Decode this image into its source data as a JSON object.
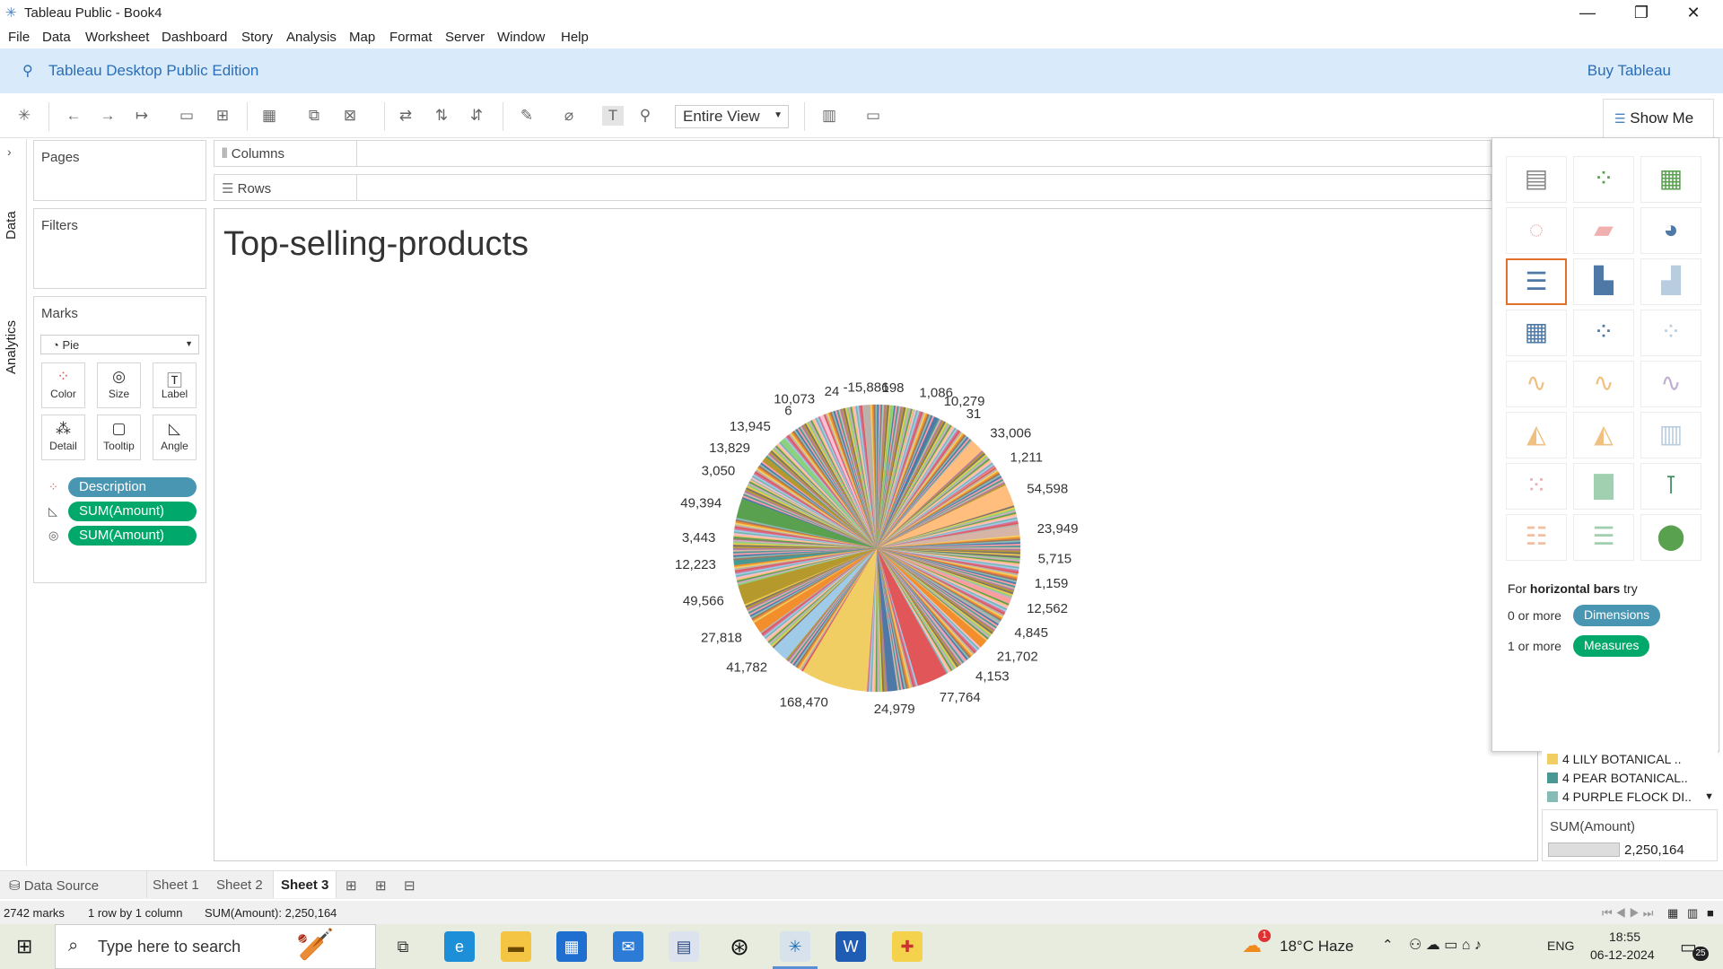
{
  "window": {
    "title": "Tableau Public - Book4",
    "minimize": "—",
    "restore": "❐",
    "close": "✕"
  },
  "menu": [
    "File",
    "Data",
    "Worksheet",
    "Dashboard",
    "Story",
    "Analysis",
    "Map",
    "Format",
    "Server",
    "Window",
    "Help"
  ],
  "banner": {
    "edition": "Tableau Desktop Public Edition",
    "buy": "Buy Tableau"
  },
  "toolbar": {
    "fit": "Entire View",
    "show_me": "Show Me"
  },
  "side_tabs": {
    "data": "Data",
    "analytics": "Analytics"
  },
  "cards": {
    "pages": "Pages",
    "filters": "Filters",
    "marks": "Marks",
    "mark_type": "Pie",
    "buttons": [
      "Color",
      "Size",
      "Label",
      "Detail",
      "Tooltip",
      "Angle"
    ],
    "pills": [
      {
        "label": "Description",
        "color": "#4996b2",
        "icon": "color-dots-icon"
      },
      {
        "label": "SUM(Amount)",
        "color": "#00a86b",
        "icon": "angle-icon"
      },
      {
        "label": "SUM(Amount)",
        "color": "#00a86b",
        "icon": "size-icon"
      }
    ]
  },
  "shelves": {
    "columns": "Columns",
    "rows": "Rows"
  },
  "sheet_title": "Top-selling-products",
  "chart_data": {
    "type": "pie",
    "title": "Top-selling-products",
    "total": 2250164,
    "marks": 2742,
    "labeled_slices": [
      {
        "label": "168,470",
        "value": 168470,
        "color": "#f1ce63"
      },
      {
        "label": "77,764",
        "value": 77764,
        "color": "#e15759"
      },
      {
        "label": "54,598",
        "value": 54598,
        "color": "#ffbe7d"
      },
      {
        "label": "49,566",
        "value": 49566,
        "color": "#b6992d"
      },
      {
        "label": "49,394",
        "value": 49394,
        "color": "#59a14f"
      },
      {
        "label": "41,782",
        "value": 41782,
        "color": "#a0cbe8"
      },
      {
        "label": "33,006",
        "value": 33006,
        "color": "#ffbe7d"
      },
      {
        "label": "27,818",
        "value": 27818,
        "color": "#f28e2b"
      },
      {
        "label": "24,979",
        "value": 24979,
        "color": "#4e79a7"
      },
      {
        "label": "23,949",
        "value": 23949,
        "color": "#d7b5a6"
      },
      {
        "label": "21,702",
        "value": 21702,
        "color": "#f28e2b"
      },
      {
        "label": "13,945",
        "value": 13945,
        "color": "#8cd17d"
      },
      {
        "label": "13,829",
        "value": 13829,
        "color": "#b6992d"
      },
      {
        "label": "12,562",
        "value": 12562,
        "color": "#ff9d9a"
      },
      {
        "label": "12,223",
        "value": 12223,
        "color": "#499894"
      },
      {
        "label": "10,279",
        "value": 10279,
        "color": "#4e79a7"
      },
      {
        "label": "10,073",
        "value": 10073,
        "color": "#fabfd2"
      },
      {
        "label": "5,715",
        "value": 5715,
        "color": "#79706e"
      },
      {
        "label": "4,845",
        "value": 4845,
        "color": "#bab0ac"
      },
      {
        "label": "4,153",
        "value": 4153,
        "color": "#d4a6c8"
      },
      {
        "label": "3,443",
        "value": 3443,
        "color": "#9d7660"
      },
      {
        "label": "3,050",
        "value": 3050,
        "color": "#86bcb6"
      },
      {
        "label": "1,211",
        "value": 1211,
        "color": "#f1ce63"
      },
      {
        "label": "1,159",
        "value": 1159,
        "color": "#e15759"
      },
      {
        "label": "1,086",
        "value": 1086,
        "color": "#76b7b2"
      },
      {
        "label": "198",
        "value": 198,
        "color": "#59a14f"
      },
      {
        "label": "31",
        "value": 31,
        "color": "#edc948"
      },
      {
        "label": "24",
        "value": 24,
        "color": "#ff9da7"
      },
      {
        "label": "6",
        "value": 6,
        "color": "#9c755f"
      },
      {
        "label": "-15,886",
        "value": -15886,
        "color": "#bab0ac"
      }
    ]
  },
  "show_me": {
    "hint_prefix": "For ",
    "hint_bold": "horizontal bars",
    "hint_suffix": " try",
    "dims_prefix": "0 or more",
    "dims_badge": "Dimensions",
    "meas_prefix": "1 or more",
    "meas_badge": "Measures",
    "dims_color": "#4996b2",
    "meas_color": "#00a86b"
  },
  "legend": {
    "items": [
      {
        "label": "4 LILY BOTANICAL ..",
        "color": "#f1ce63"
      },
      {
        "label": "4 PEAR BOTANICAL..",
        "color": "#499894"
      },
      {
        "label": "4 PURPLE FLOCK DI..",
        "color": "#86bcb6"
      }
    ],
    "size_title": "SUM(Amount)",
    "size_value": "2,250,164"
  },
  "sheet_tabs": {
    "data_source": "Data Source",
    "sheets": [
      "Sheet 1",
      "Sheet 2",
      "Sheet 3"
    ],
    "active": "Sheet 3"
  },
  "status": {
    "marks": "2742 marks",
    "dims": "1 row by 1 column",
    "sum": "SUM(Amount): 2,250,164"
  },
  "taskbar": {
    "search_placeholder": "Type here to search",
    "weather": "18°C  Haze",
    "lang": "ENG",
    "time": "18:55",
    "date": "06-12-2024",
    "notif_count": "25",
    "weather_badge": "1"
  }
}
